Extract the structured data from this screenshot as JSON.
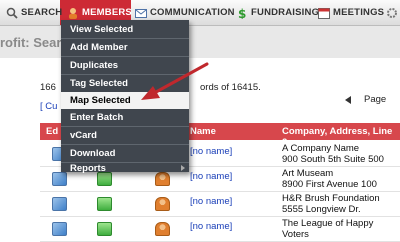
{
  "nav": {
    "items": [
      {
        "label": "SEARCH",
        "icon": "search-icon"
      },
      {
        "label": "MEMBERS",
        "icon": "members-icon"
      },
      {
        "label": "COMMUNICATION",
        "icon": "envelope-icon"
      },
      {
        "label": "FUNDRAISING",
        "icon": "dollar-icon"
      },
      {
        "label": "MEETINGS",
        "icon": "calendar-icon"
      }
    ],
    "active_color": "#cd2a35"
  },
  "header": {
    "title": "rofit: Sear"
  },
  "summary": {
    "left": "166",
    "right": "ords of 16415.",
    "link": "[ Cu"
  },
  "pager": {
    "label": "Page"
  },
  "table": {
    "headers": [
      "Ed",
      "Name",
      "Company, Address, Line 2"
    ],
    "rows": [
      {
        "name": "[no name]",
        "line1": "A Company Name",
        "line2": "900 South 5th Suite 500"
      },
      {
        "name": "[no name]",
        "line1": "Art Museam",
        "line2": "8900 First Avenue 100"
      },
      {
        "name": "[no name]",
        "line1": "H&R Brush Foundation",
        "line2": "5555 Longview Dr."
      },
      {
        "name": "[no name]",
        "line1": "The League of Happy",
        "line2": "Voters"
      }
    ]
  },
  "menu": {
    "items": [
      {
        "label": "View Selected"
      },
      {
        "label": "Add Member"
      },
      {
        "label": "Duplicates"
      },
      {
        "label": "Tag Selected"
      },
      {
        "label": "Map Selected"
      },
      {
        "label": "Enter Batch"
      },
      {
        "label": "vCard"
      },
      {
        "label": "Download"
      },
      {
        "label": "Reports"
      }
    ],
    "highlighted": "Map Selected",
    "highlight_color": "#f3f3f3",
    "background_color": "#40464e"
  },
  "annotation": {
    "color": "#c0282d"
  }
}
